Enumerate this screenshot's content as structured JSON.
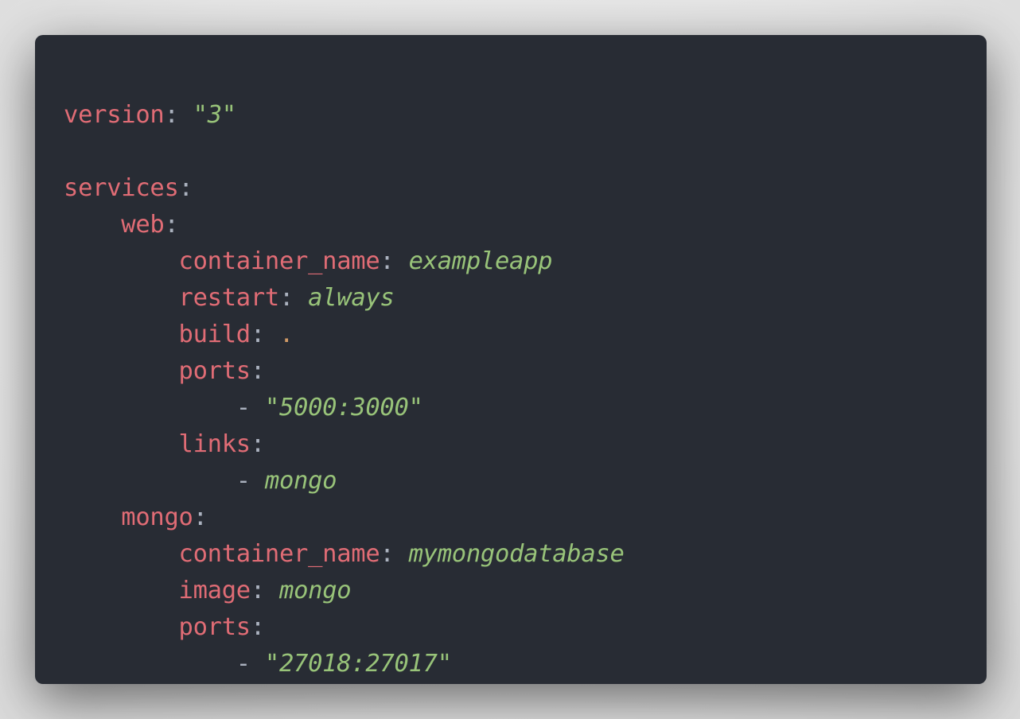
{
  "colors": {
    "background": "#282c34",
    "key": "#e06c75",
    "string": "#98c379",
    "punctuation": "#abb2bf",
    "number_dot": "#d19a66"
  },
  "code": {
    "language": "yaml",
    "lines": [
      {
        "indent": "",
        "key": "version",
        "value": "3",
        "value_type": "quoted"
      },
      {
        "indent": "",
        "key": "",
        "value": "",
        "value_type": "blank"
      },
      {
        "indent": "",
        "key": "services",
        "value": "",
        "value_type": "none"
      },
      {
        "indent": "    ",
        "key": "web",
        "value": "",
        "value_type": "none"
      },
      {
        "indent": "        ",
        "key": "container_name",
        "value": "exampleapp",
        "value_type": "plain"
      },
      {
        "indent": "        ",
        "key": "restart",
        "value": "always",
        "value_type": "plain"
      },
      {
        "indent": "        ",
        "key": "build",
        "value": ".",
        "value_type": "dot"
      },
      {
        "indent": "        ",
        "key": "ports",
        "value": "",
        "value_type": "none"
      },
      {
        "indent": "            ",
        "key": "",
        "value": "5000:3000",
        "value_type": "list-quoted"
      },
      {
        "indent": "        ",
        "key": "links",
        "value": "",
        "value_type": "none"
      },
      {
        "indent": "            ",
        "key": "",
        "value": "mongo",
        "value_type": "list-plain"
      },
      {
        "indent": "    ",
        "key": "mongo",
        "value": "",
        "value_type": "none"
      },
      {
        "indent": "        ",
        "key": "container_name",
        "value": "mymongodatabase",
        "value_type": "plain"
      },
      {
        "indent": "        ",
        "key": "image",
        "value": "mongo",
        "value_type": "plain"
      },
      {
        "indent": "        ",
        "key": "ports",
        "value": "",
        "value_type": "none"
      },
      {
        "indent": "            ",
        "key": "",
        "value": "27018:27017",
        "value_type": "list-quoted"
      }
    ]
  }
}
